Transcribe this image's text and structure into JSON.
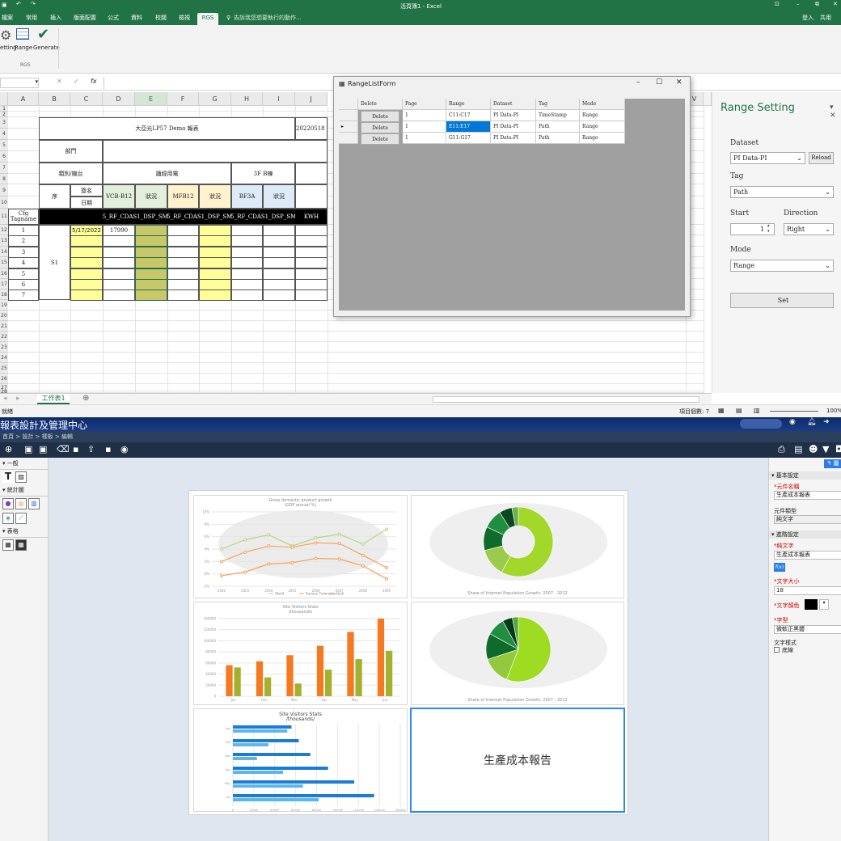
{
  "excel": {
    "title": "活頁簿1 - Excel",
    "tabs": [
      "檔案",
      "常用",
      "插入",
      "版面配置",
      "公式",
      "資料",
      "校閱",
      "檢視",
      "RGS"
    ],
    "search_placeholder": "告訴我您想要執行的動作...",
    "signin": "登入",
    "share": "共用",
    "ribbon": {
      "buttons": [
        "etting",
        "Range",
        "Generate"
      ],
      "group": "RGS"
    },
    "columns": [
      "A",
      "B",
      "C",
      "D",
      "E",
      "F",
      "G",
      "H",
      "I",
      "J"
    ],
    "rows": [
      "1",
      "2",
      "3",
      "4",
      "5",
      "6",
      "7",
      "8",
      "9",
      "10",
      "11",
      "12",
      "13",
      "14",
      "15",
      "16",
      "17",
      "18",
      "19",
      "20",
      "21",
      "22",
      "23",
      "24",
      "25",
      "26",
      "27",
      "28"
    ],
    "sheet": {
      "title": "大亞光LP57 Demo 報表",
      "date_stamp": "20220518 修訂",
      "dept": "部門",
      "cat": "類別/機台",
      "sign": "簽名",
      "date": "日期",
      "hall": "誦經用電",
      "floor": "3F B棟",
      "seq": "序",
      "vcb": "VCB-B12",
      "mfb": "MFB12",
      "bf3a": "BF3A",
      "status": "狀況",
      "cfg_tag": "Cfg Tagname",
      "tags": [
        "LP5_RF_CDAS1_DSP_SM10",
        "LP5_RF_CDAS1_DSP_SM10",
        "LP5_RF_CDAS1_DSP_SM10"
      ],
      "unit": "KWH",
      "row_nums": [
        "1",
        "2",
        "3",
        "4",
        "5",
        "6",
        "7"
      ],
      "s1": "S1",
      "first_date": "5/17/2022",
      "first_val": "17990"
    },
    "sheet_tab": "工作表1",
    "status_left": "就緒",
    "status_count": "項目個數: 7",
    "zoom": "100%"
  },
  "range_setting": {
    "title": "Range Setting",
    "dataset_label": "Dataset",
    "dataset_value": "PI Data-PI",
    "reload": "Reload",
    "tag_label": "Tag",
    "tag_value": "Path",
    "start_label": "Start",
    "start_value": "1",
    "direction_label": "Direction",
    "direction_value": "Right",
    "mode_label": "Mode",
    "mode_value": "Range",
    "set_button": "Set"
  },
  "range_list_form": {
    "title": "RangeListForm",
    "headers": [
      "Delete",
      "Page",
      "Range",
      "Dataset",
      "Tag",
      "Mode"
    ],
    "rows": [
      {
        "delete": "Delete",
        "page": "1",
        "range": "C11:C17",
        "dataset": "PI Data-PI",
        "tag": "TimeStamp",
        "mode": "Range"
      },
      {
        "delete": "Delete",
        "page": "1",
        "range": "E11:E17",
        "dataset": "PI Data-PI",
        "tag": "Path",
        "mode": "Range"
      },
      {
        "delete": "Delete",
        "page": "1",
        "range": "G11:G17",
        "dataset": "PI Data-PI",
        "tag": "Path",
        "mode": "Range"
      }
    ]
  },
  "app": {
    "title": "報表設計及管理中心",
    "breadcrumb": "首頁 > 設計 > 樣板 > 編輯",
    "left": {
      "general": "一般",
      "stats": "統計圖",
      "table": "表格"
    },
    "right": {
      "basic": "基本設定",
      "name_label": "*元件名稱",
      "name_value": "生產成本報表",
      "type_label": "元件類型",
      "type_value": "純文字",
      "advanced": "進階設定",
      "text_label": "*純文字",
      "text_value": "生產成本報表",
      "fx": "f(x)",
      "size_label": "*文字大小",
      "size_value": "18",
      "color_label": "*文字顏色",
      "font_label": "*字型",
      "font_value": "微軟正黑體",
      "style_label": "文字樣式",
      "underline": "底線"
    },
    "report_text": "生產成本報告",
    "panels": {
      "line_title": "Gross domestic product growth",
      "line_sub": "(GDP annual %)",
      "line_legend": [
        "World",
        "Russian Federation",
        "Haiti"
      ],
      "donut_caption": "Share of Internet Population Growth, 2007 - 2012",
      "bar_title": "Site Visitors Stats",
      "bar_sub": "/thousands/",
      "pie_caption": "Share of Internet Population Growth, 2007 - 2012",
      "hbar_title": "Site Visitors Stats",
      "hbar_sub": "/thousands/"
    }
  },
  "chart_data": [
    {
      "type": "line",
      "title": "Gross domestic product growth",
      "subtitle": "(GDP annual %)",
      "categories": [
        "2002",
        "2003",
        "2004",
        "2005",
        "2006",
        "2007",
        "2008",
        "2009"
      ],
      "series": [
        {
          "name": "World",
          "values": [
            4.0,
            5.5,
            6.3,
            4.5,
            5.8,
            6.4,
            4.8,
            7.2
          ]
        },
        {
          "name": "Russian Federation",
          "values": [
            2.0,
            3.5,
            4.5,
            4.3,
            5.0,
            4.9,
            3.0,
            1.0
          ]
        },
        {
          "name": "Haiti",
          "values": [
            -0.3,
            0.3,
            1.6,
            1.8,
            2.5,
            2.4,
            1.3,
            -0.8
          ]
        }
      ],
      "ylim": [
        -2,
        10
      ],
      "grid": true,
      "legend": "bottom"
    },
    {
      "type": "bar",
      "title": "Site Visitors Stats",
      "subtitle": "/thousands/",
      "categories": [
        "Jan",
        "Feb",
        "Mar",
        "Apr",
        "May",
        "Jun"
      ],
      "series": [
        {
          "values": [
            56000,
            63000,
            74000,
            91000,
            116000,
            140000
          ]
        },
        {
          "values": [
            52000,
            34000,
            23000,
            48000,
            67000,
            82000
          ]
        }
      ],
      "ylim": [
        0,
        140000
      ],
      "grid": true
    },
    {
      "type": "bar",
      "title": "Site Visitors Stats",
      "subtitle": "/thousands/",
      "orientation": "horizontal",
      "categories": [
        "Jan",
        "Feb",
        "Mar",
        "Apr",
        "May",
        "Jun"
      ],
      "series": [
        {
          "values": [
            56000,
            63000,
            74000,
            91000,
            116000,
            135000
          ]
        },
        {
          "values": [
            52000,
            34000,
            23000,
            48000,
            67000,
            82000
          ]
        }
      ],
      "xlim": [
        0,
        160000
      ],
      "grid": true
    },
    {
      "type": "pie",
      "subtitle": "Share of Internet Population Growth, 2007 - 2012",
      "values": [
        58,
        13,
        11,
        9,
        6,
        3
      ],
      "colors": [
        "#a2d82a",
        "#9acb4a",
        "#0e6b2b",
        "#1f8f3f",
        "#0a4a22",
        "#6ab24a"
      ],
      "donut": true
    },
    {
      "type": "pie",
      "subtitle": "Share of Internet Population Growth, 2007 - 2012",
      "values": [
        56,
        14,
        13,
        9,
        5,
        3
      ],
      "colors": [
        "#9ddc21",
        "#94c93e",
        "#0e6b2b",
        "#1f8f3f",
        "#08391b",
        "#57a83b"
      ]
    }
  ]
}
